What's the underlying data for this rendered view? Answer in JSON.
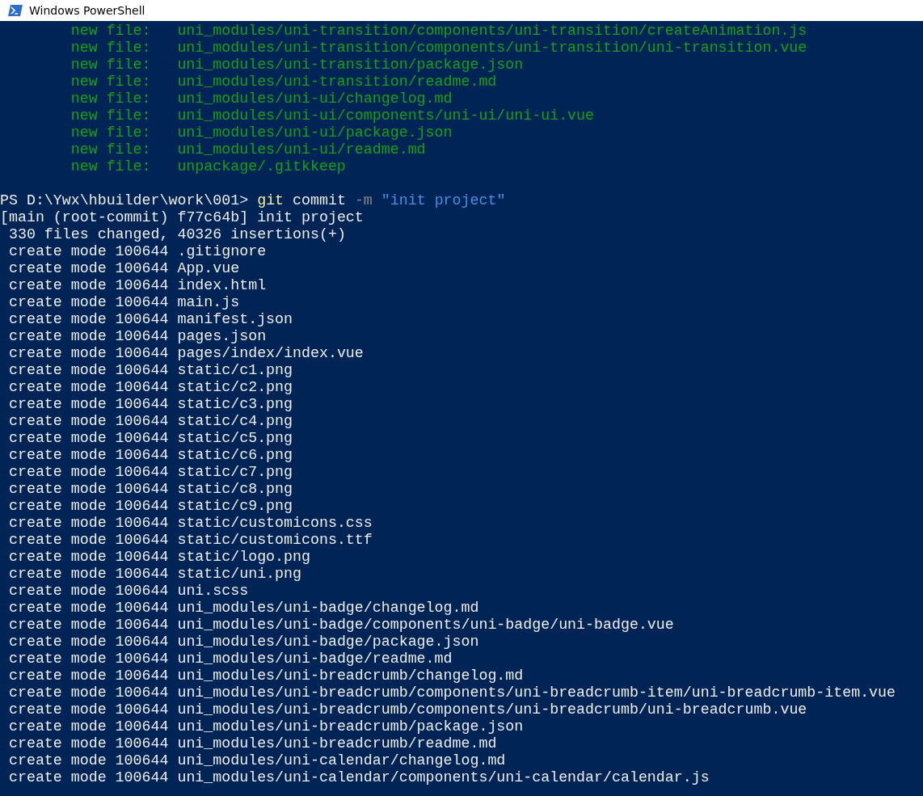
{
  "window": {
    "title": "Windows PowerShell"
  },
  "lines": [
    {
      "kind": "staged",
      "text": "new file:   uni_modules/uni-transition/components/uni-transition/createAnimation.js"
    },
    {
      "kind": "staged",
      "text": "new file:   uni_modules/uni-transition/components/uni-transition/uni-transition.vue"
    },
    {
      "kind": "staged",
      "text": "new file:   uni_modules/uni-transition/package.json"
    },
    {
      "kind": "staged",
      "text": "new file:   uni_modules/uni-transition/readme.md"
    },
    {
      "kind": "staged",
      "text": "new file:   uni_modules/uni-ui/changelog.md"
    },
    {
      "kind": "staged",
      "text": "new file:   uni_modules/uni-ui/components/uni-ui/uni-ui.vue"
    },
    {
      "kind": "staged",
      "text": "new file:   uni_modules/uni-ui/package.json"
    },
    {
      "kind": "staged",
      "text": "new file:   uni_modules/uni-ui/readme.md"
    },
    {
      "kind": "staged",
      "text": "new file:   unpackage/.gitkkeep"
    },
    {
      "kind": "prompt",
      "path": "PS D:\\Ywx\\hbuilder\\work\\001>",
      "tokens": [
        {
          "kind": "command",
          "text": "git"
        },
        {
          "kind": "argument",
          "text": "commit"
        },
        {
          "kind": "parameter",
          "text": "-m"
        },
        {
          "kind": "string",
          "text": "\"init project\""
        }
      ]
    },
    {
      "kind": "header",
      "text": "[main (root-commit) f77c64b] init project"
    },
    {
      "kind": "output",
      "text": "330 files changed, 40326 insertions(+)"
    },
    {
      "kind": "output",
      "text": "create mode 100644 .gitignore"
    },
    {
      "kind": "output",
      "text": "create mode 100644 App.vue"
    },
    {
      "kind": "output",
      "text": "create mode 100644 index.html"
    },
    {
      "kind": "output",
      "text": "create mode 100644 main.js"
    },
    {
      "kind": "output",
      "text": "create mode 100644 manifest.json"
    },
    {
      "kind": "output",
      "text": "create mode 100644 pages.json"
    },
    {
      "kind": "output",
      "text": "create mode 100644 pages/index/index.vue"
    },
    {
      "kind": "output",
      "text": "create mode 100644 static/c1.png"
    },
    {
      "kind": "output",
      "text": "create mode 100644 static/c2.png"
    },
    {
      "kind": "output",
      "text": "create mode 100644 static/c3.png"
    },
    {
      "kind": "output",
      "text": "create mode 100644 static/c4.png"
    },
    {
      "kind": "output",
      "text": "create mode 100644 static/c5.png"
    },
    {
      "kind": "output",
      "text": "create mode 100644 static/c6.png"
    },
    {
      "kind": "output",
      "text": "create mode 100644 static/c7.png"
    },
    {
      "kind": "output",
      "text": "create mode 100644 static/c8.png"
    },
    {
      "kind": "output",
      "text": "create mode 100644 static/c9.png"
    },
    {
      "kind": "output",
      "text": "create mode 100644 static/customicons.css"
    },
    {
      "kind": "output",
      "text": "create mode 100644 static/customicons.ttf"
    },
    {
      "kind": "output",
      "text": "create mode 100644 static/logo.png"
    },
    {
      "kind": "output",
      "text": "create mode 100644 static/uni.png"
    },
    {
      "kind": "output",
      "text": "create mode 100644 uni.scss"
    },
    {
      "kind": "output",
      "text": "create mode 100644 uni_modules/uni-badge/changelog.md"
    },
    {
      "kind": "output",
      "text": "create mode 100644 uni_modules/uni-badge/components/uni-badge/uni-badge.vue"
    },
    {
      "kind": "output",
      "text": "create mode 100644 uni_modules/uni-badge/package.json"
    },
    {
      "kind": "output",
      "text": "create mode 100644 uni_modules/uni-badge/readme.md"
    },
    {
      "kind": "output",
      "text": "create mode 100644 uni_modules/uni-breadcrumb/changelog.md"
    },
    {
      "kind": "output",
      "text": "create mode 100644 uni_modules/uni-breadcrumb/components/uni-breadcrumb-item/uni-breadcrumb-item.vue"
    },
    {
      "kind": "output",
      "text": "create mode 100644 uni_modules/uni-breadcrumb/components/uni-breadcrumb/uni-breadcrumb.vue"
    },
    {
      "kind": "output",
      "text": "create mode 100644 uni_modules/uni-breadcrumb/package.json"
    },
    {
      "kind": "output",
      "text": "create mode 100644 uni_modules/uni-breadcrumb/readme.md"
    },
    {
      "kind": "output",
      "text": "create mode 100644 uni_modules/uni-calendar/changelog.md"
    },
    {
      "kind": "output",
      "text": "create mode 100644 uni_modules/uni-calendar/components/uni-calendar/calendar.js"
    }
  ]
}
